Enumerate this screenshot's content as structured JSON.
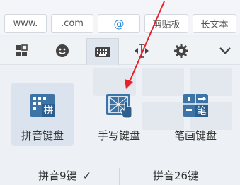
{
  "shortcuts": {
    "www": "www.",
    "com": ".com",
    "at": "@",
    "clipboard": "剪贴板",
    "long_text": "长文本"
  },
  "keyboards": [
    {
      "label": "拼音键盘",
      "icon": "pinyin-keyboard-icon",
      "glyph": "拼",
      "selected": true
    },
    {
      "label": "手写键盘",
      "icon": "handwriting-keyboard-icon",
      "selected": false
    },
    {
      "label": "笔画键盘",
      "icon": "stroke-keyboard-icon",
      "glyph": "笔",
      "selected": false
    }
  ],
  "modes": {
    "pinyin9": "拼音9键",
    "pinyin26": "拼音26键",
    "check": "✓"
  },
  "colors": {
    "icon_blue": "#3c74a8",
    "arrow_red": "#e8202a",
    "at_blue": "#2e87d8"
  }
}
